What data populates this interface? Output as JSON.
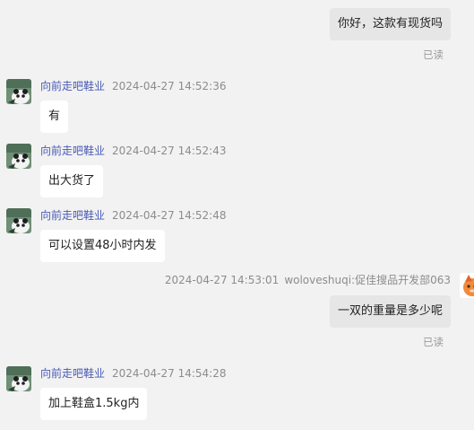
{
  "messages": [
    {
      "direction": "out",
      "text": "你好，这款有现货吗",
      "status": "已读"
    },
    {
      "direction": "in",
      "sender": "向前走吧鞋业",
      "timestamp": "2024-04-27 14:52:36",
      "text": "有",
      "avatar_icon": "panda-avatar-icon"
    },
    {
      "direction": "in",
      "sender": "向前走吧鞋业",
      "timestamp": "2024-04-27 14:52:43",
      "text": "出大货了",
      "avatar_icon": "panda-avatar-icon"
    },
    {
      "direction": "in",
      "sender": "向前走吧鞋业",
      "timestamp": "2024-04-27 14:52:48",
      "text": "可以设置48小时内发",
      "avatar_icon": "panda-avatar-icon"
    },
    {
      "direction": "out",
      "sender": "woloveshuqi:促佳搜品开发部063",
      "timestamp": "2024-04-27 14:53:01",
      "text": "一双的重量是多少呢",
      "status": "已读",
      "avatar_icon": "orange-character-avatar-icon"
    },
    {
      "direction": "in",
      "sender": "向前走吧鞋业",
      "timestamp": "2024-04-27 14:54:28",
      "text": "加上鞋盒1.5kg内",
      "avatar_icon": "panda-avatar-icon"
    }
  ],
  "colors": {
    "background": "#f2f2f2",
    "incoming_bubble": "#ffffff",
    "outgoing_bubble": "#e6e6e6",
    "sender_name": "#4a5bb5",
    "meta_text": "#8c8c8c"
  }
}
